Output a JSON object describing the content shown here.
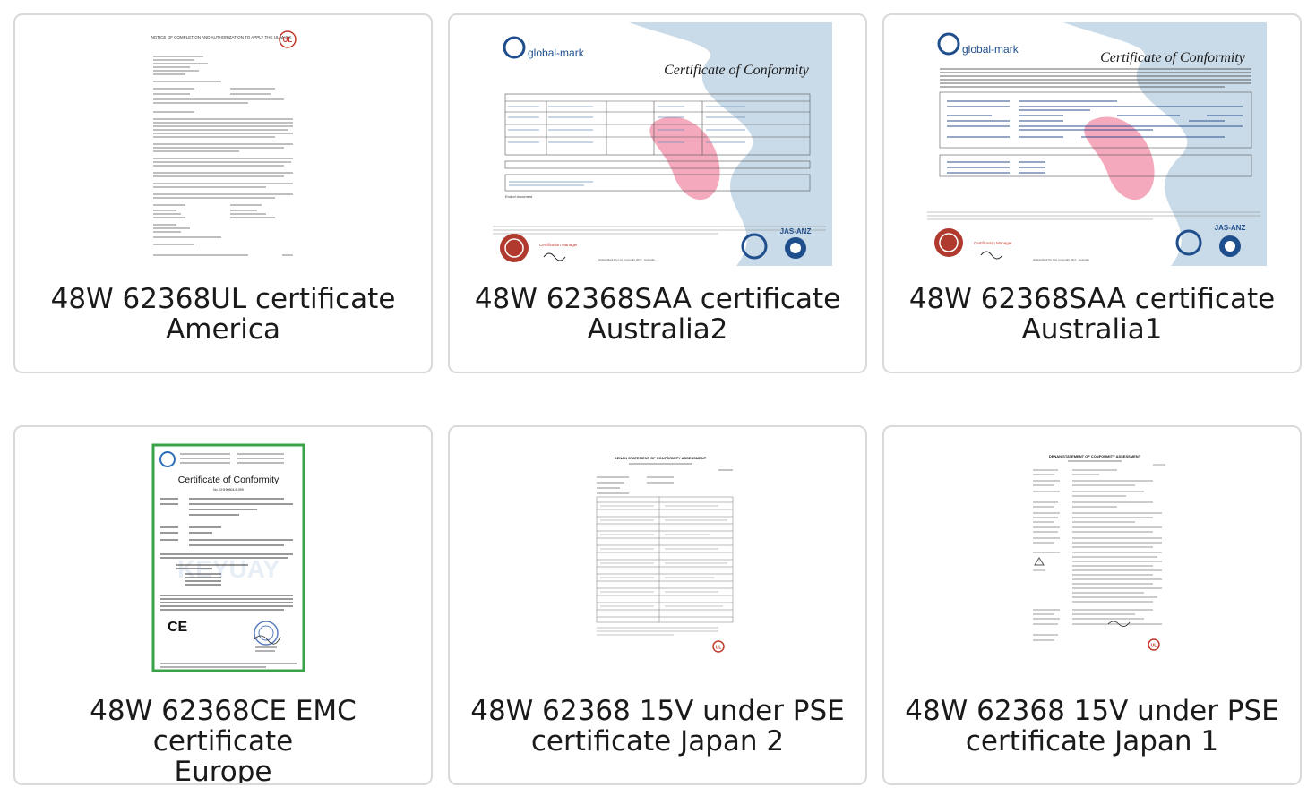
{
  "cards": [
    {
      "line1": "48W 62368UL certificate",
      "line2": "America",
      "doc": {
        "title": "NOTICE OF COMPLETION AND AUTHORIZATION TO APPLY THE UL MARK"
      }
    },
    {
      "line1": "48W 62368SAA certificate",
      "line2": "Australia2",
      "doc": {
        "brand": "global-mark",
        "title": "Certificate of Conformity",
        "footer_left": "Certification Manager",
        "badge": "JAS-ANZ",
        "end": "End of document"
      }
    },
    {
      "line1": "48W 62368SAA certificate",
      "line2": "Australia1",
      "doc": {
        "brand": "global-mark",
        "title": "Certificate of Conformity",
        "footer_left": "Certification Manager",
        "badge": "JAS-ANZ"
      }
    },
    {
      "line1": "48W 62368CE EMC certificate",
      "line2": "Europe",
      "doc": {
        "title": "Certificate of Conformity",
        "mark": "CE",
        "num": "No. CH190504-E-099"
      }
    },
    {
      "line1": "48W 62368 15V under PSE",
      "line2": "certificate Japan 2",
      "doc": {
        "title": "DENAN STATEMENT OF CONFORMITY ASSESSMENT"
      }
    },
    {
      "line1": "48W 62368 15V under PSE",
      "line2": "certificate Japan 1",
      "doc": {
        "title": "DENAN STATEMENT OF CONFORMITY ASSESSMENT"
      }
    }
  ],
  "colors": {
    "card_border": "#d9d9d9",
    "gm_blue": "#1f4e8c",
    "gm_pink": "#f29bb0",
    "ce_green": "#3aa34a",
    "ul_red": "#c0392b"
  }
}
